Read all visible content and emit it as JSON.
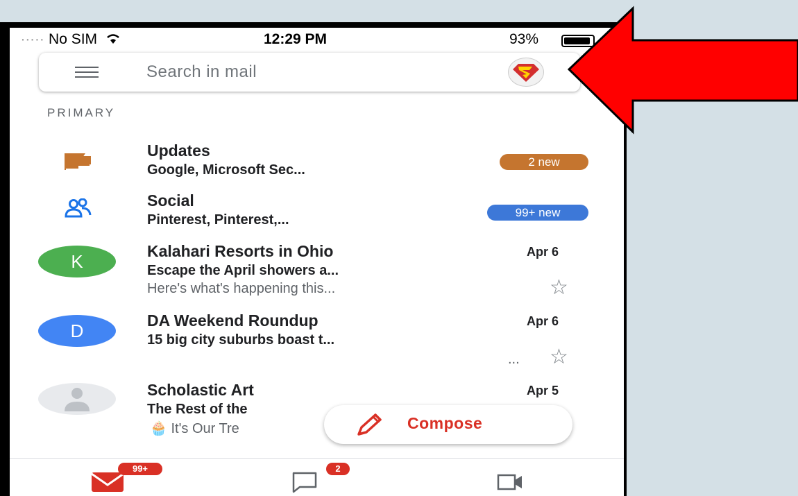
{
  "status_bar": {
    "carrier_dots": "∙∙∙∙∙",
    "carrier": "No SIM",
    "time": "12:29 PM",
    "battery": "93%"
  },
  "search": {
    "placeholder": "Search in mail"
  },
  "section": {
    "label": "PRIMARY"
  },
  "categories": [
    {
      "title": "Updates",
      "subtitle": "Google, Microsoft Sec...",
      "badge": "2 new",
      "badge_color": "#c5752f",
      "icon": "flag-icon",
      "icon_color": "#c5752f"
    },
    {
      "title": "Social",
      "subtitle": "Pinterest, Pinterest,...",
      "badge": "99+ new",
      "badge_color": "#3d78d8",
      "icon": "people-icon",
      "icon_color": "#1a73e8"
    }
  ],
  "emails": [
    {
      "avatar_letter": "K",
      "avatar_color": "#4caf50",
      "sender": "Kalahari Resorts in Ohio",
      "date": "Apr 6",
      "subject": "Escape the April showers a...",
      "snippet": "Here's what's happening this...",
      "star": "☆"
    },
    {
      "avatar_letter": "D",
      "avatar_color": "#4285f4",
      "sender": "DA Weekend Roundup",
      "date": "Apr 6",
      "subject": "15 big city suburbs boast t...",
      "snippet": "...",
      "star": "☆"
    },
    {
      "avatar_letter": "",
      "avatar_color": "#e8eaed",
      "sender": "Scholastic Art",
      "date": "Apr 5",
      "subject": "The Rest of the",
      "snippet": "🧁 It's Our Tre",
      "star": "☆"
    }
  ],
  "compose": {
    "label": "Compose"
  },
  "tabbar": {
    "mail_badge": "99+",
    "chat_badge": "2"
  },
  "accent": {
    "red": "#d93025",
    "arrow": "#ff0000"
  }
}
